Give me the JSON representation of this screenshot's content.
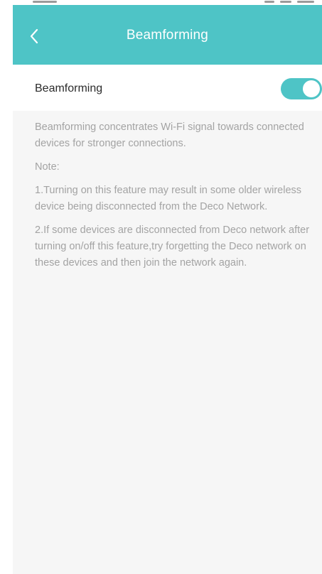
{
  "header": {
    "title": "Beamforming",
    "back_icon": "chevron-left-icon",
    "background_color": "#4ec4c6"
  },
  "setting": {
    "label": "Beamforming",
    "enabled": true,
    "toggle_color": "#4ec4c6"
  },
  "description": {
    "intro": "Beamforming concentrates Wi-Fi signal towards connected devices for stronger connections.",
    "note_label": "Note:",
    "note_1": "1.Turning on this feature may result in some older wireless device being disconnected from the Deco Network.",
    "note_2": "2.If some devices are disconnected from Deco network after turning on/off this feature,try forgetting the Deco network on these devices and then join the network again."
  }
}
